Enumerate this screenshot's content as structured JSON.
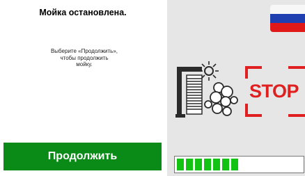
{
  "screen": {
    "title": "Мойка остановлена.",
    "message": "Выберите «Продолжить»,\nчтобы продолжить\nмойку.",
    "continue_button_label": "Продолжить",
    "stop_sign_text": "STOP",
    "language_flag": "russia-flag-icon",
    "progress": {
      "filled_segments": 7,
      "fraction": 0.43
    }
  },
  "colors": {
    "continue_button": "#0a8a16",
    "stop_red": "#e02020",
    "progress_green": "#13c313",
    "right_panel_bg": "#e6e6e6"
  },
  "icons": [
    "car-wash-icon",
    "stop-sign-icon",
    "russia-flag-icon"
  ]
}
